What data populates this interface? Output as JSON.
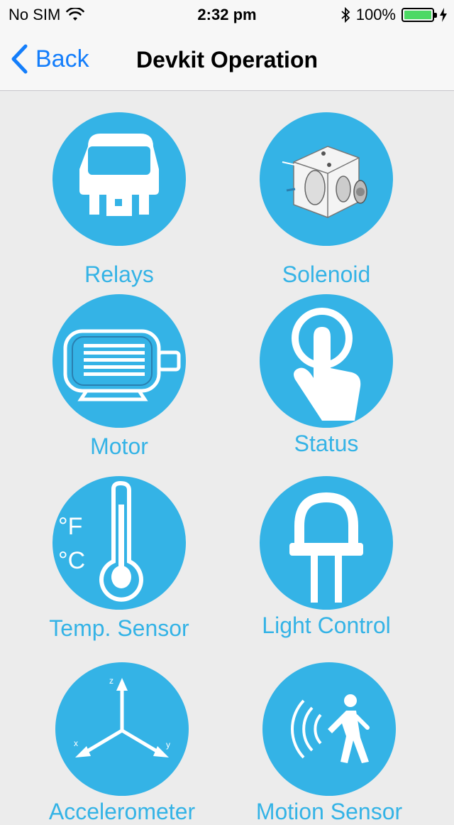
{
  "status_bar": {
    "carrier": "No SIM",
    "time": "2:32 pm",
    "battery": "100%"
  },
  "nav": {
    "back_label": "Back",
    "title": "Devkit Operation"
  },
  "colors": {
    "accent": "#34b3e6",
    "ios_blue": "#147efb",
    "background": "#ececec"
  },
  "tiles": [
    {
      "label": "Relays",
      "icon": "relay-icon"
    },
    {
      "label": "Solenoid",
      "icon": "solenoid-icon"
    },
    {
      "label": "Motor",
      "icon": "motor-icon"
    },
    {
      "label": "Status",
      "icon": "touch-icon"
    },
    {
      "label": "Temp. Sensor",
      "icon": "thermometer-icon",
      "units": [
        "°F",
        "°C"
      ]
    },
    {
      "label": "Light Control",
      "icon": "led-icon"
    },
    {
      "label": "Accelerometer",
      "icon": "axes-icon",
      "axes": [
        "z",
        "x",
        "y"
      ]
    },
    {
      "label": "Motion Sensor",
      "icon": "motion-sensor-icon"
    }
  ]
}
